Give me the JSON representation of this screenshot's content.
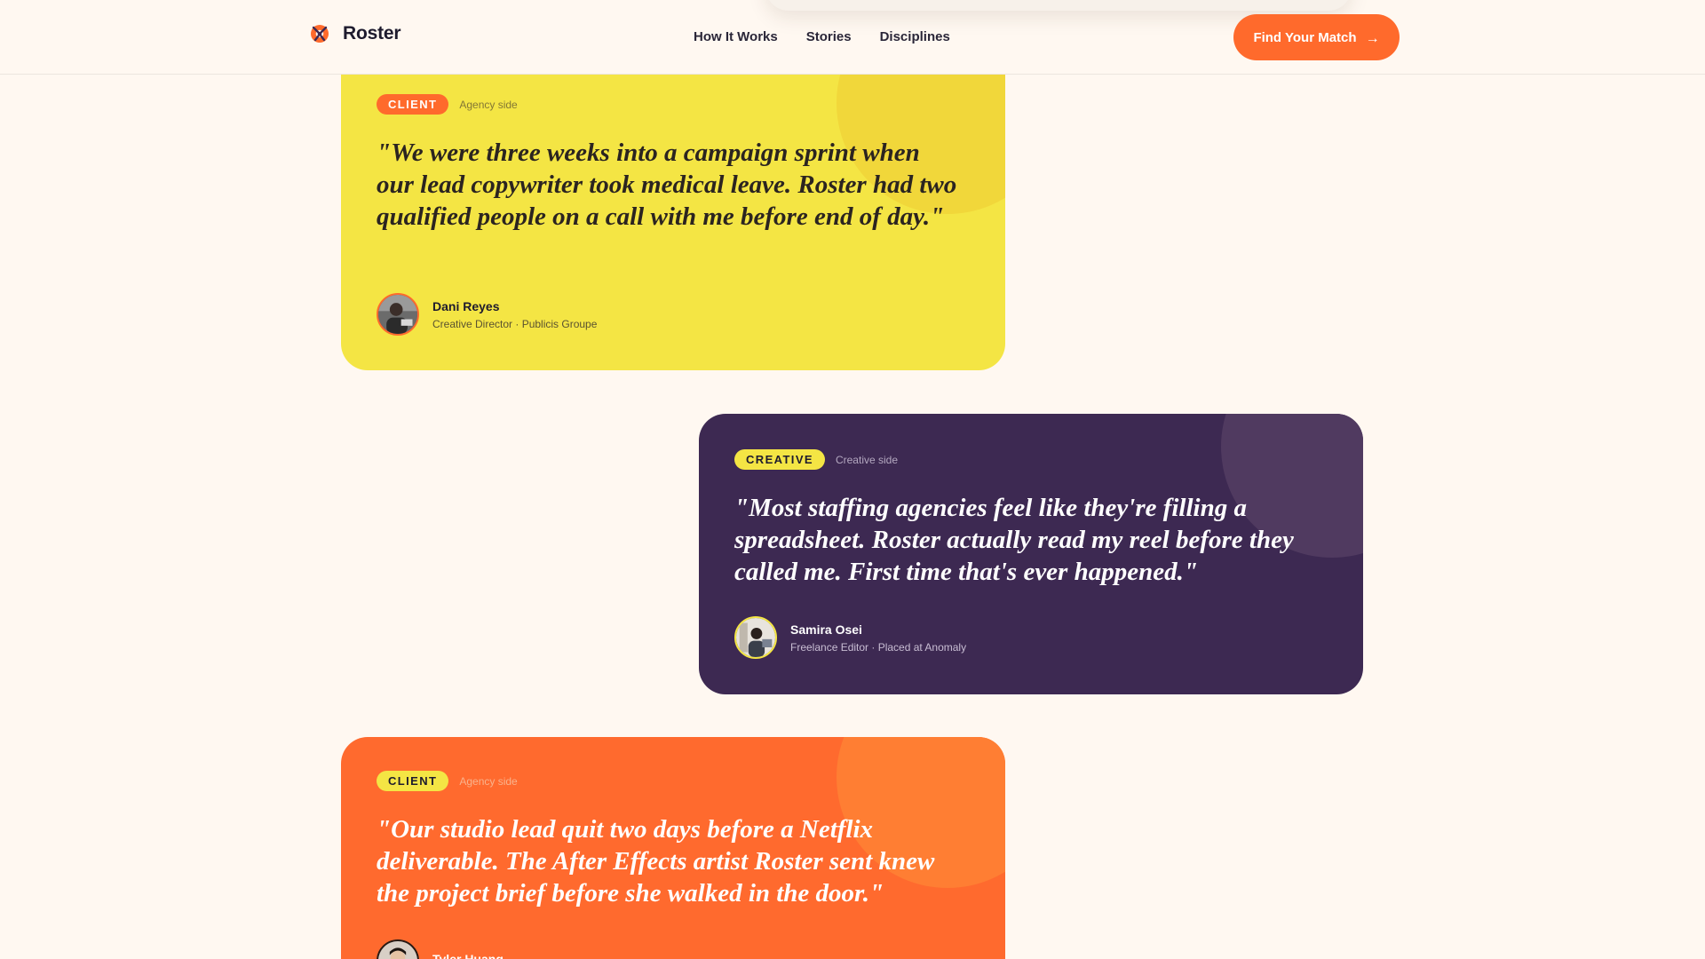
{
  "header": {
    "brand_name": "Roster",
    "brand_icon": "roster-logo-icon",
    "nav": [
      {
        "label": "How It Works"
      },
      {
        "label": "Stories"
      },
      {
        "label": "Disciplines"
      }
    ],
    "cta": {
      "label": "Find Your Match",
      "arrow": "→"
    }
  },
  "testimonials": [
    {
      "badge": "CLIENT",
      "side": "Agency side",
      "quote": "\"We were three weeks into a campaign sprint when our lead copywriter took medical leave. Roster had two qualified people on a call with me before end of day.\"",
      "author_name": "Dani Reyes",
      "author_title": "Creative Director · Publicis Groupe"
    },
    {
      "badge": "CREATIVE",
      "side": "Creative side",
      "quote": "\"Most staffing agencies feel like they're filling a spreadsheet. Roster actually read my reel before they called me. First time that's ever happened.\"",
      "author_name": "Samira Osei",
      "author_title": "Freelance Editor · Placed at Anomaly"
    },
    {
      "badge": "CLIENT",
      "side": "Agency side",
      "quote": "\"Our studio lead quit two days before a Netflix deliverable. The After Effects artist Roster sent knew the project brief before she walked in the door.\"",
      "author_name": "Tyler Huang",
      "author_title": ""
    }
  ],
  "colors": {
    "page_bg": "#fff8f1",
    "accent_orange": "#ff6a2c",
    "card_yellow": "#f4e544",
    "card_purple": "#3d2952",
    "card_orange": "#ff6a2e"
  }
}
